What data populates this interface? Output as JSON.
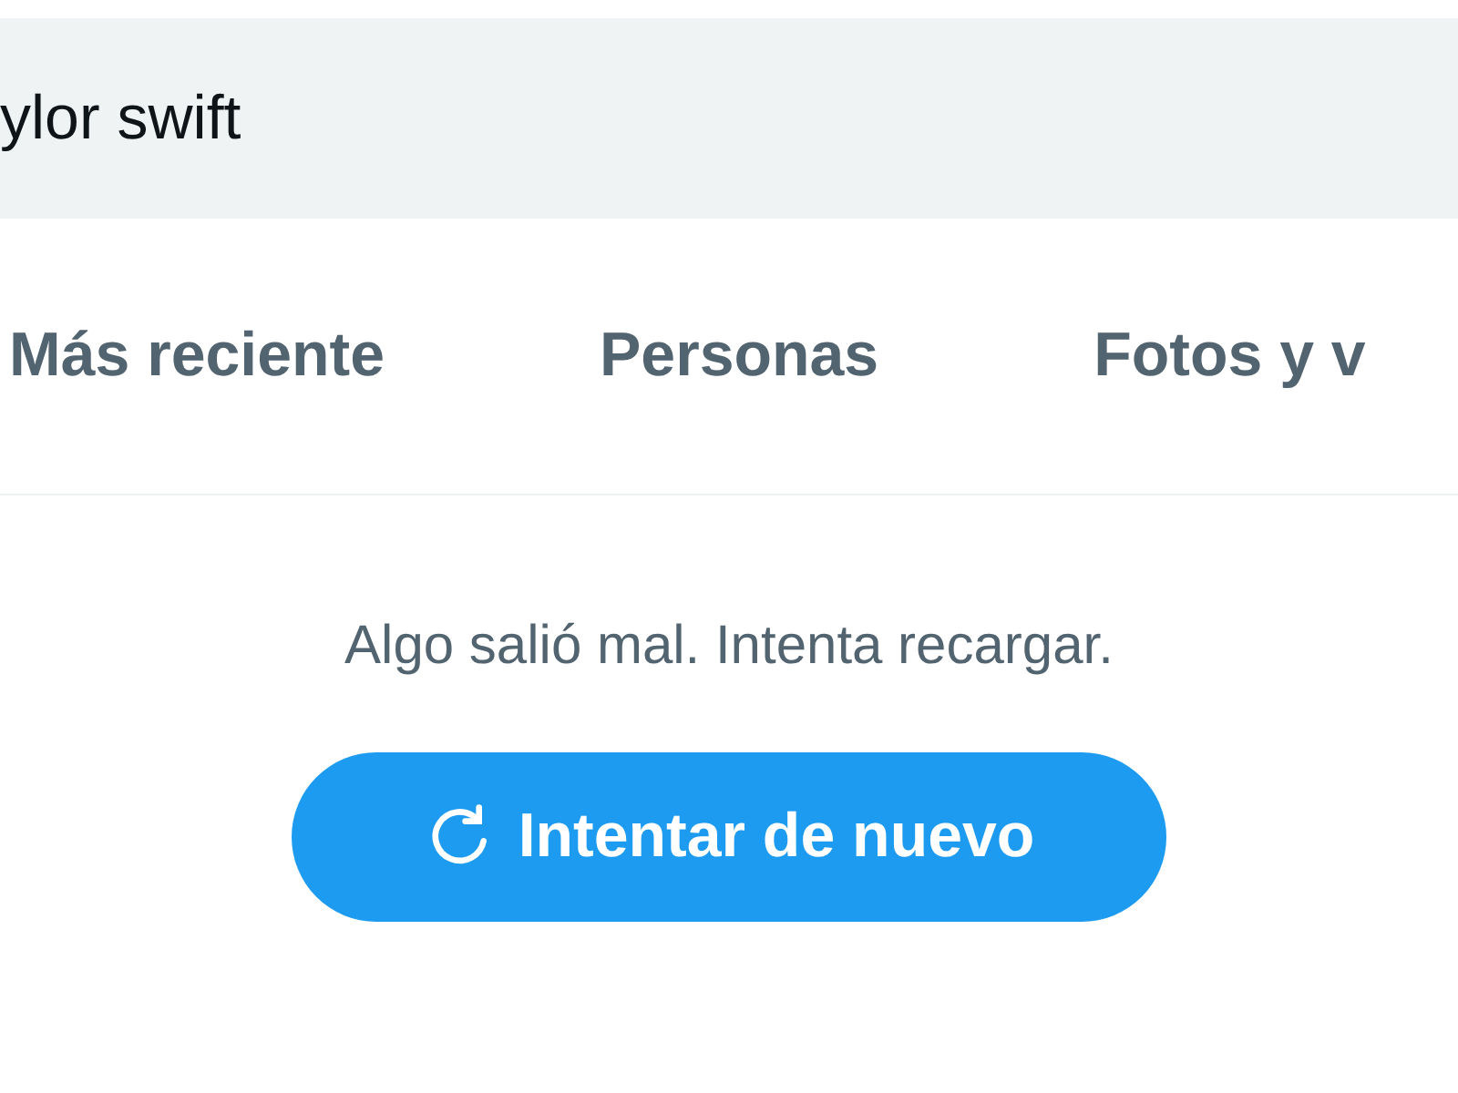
{
  "search": {
    "value": "ylor swift"
  },
  "tabs": [
    {
      "label": "Más reciente",
      "selected": false
    },
    {
      "label": "Personas",
      "selected": false
    },
    {
      "label": "Fotos y v",
      "selected": false
    }
  ],
  "error": {
    "message": "Algo salió mal. Intenta recargar.",
    "button": "Intentar de nuevo"
  }
}
